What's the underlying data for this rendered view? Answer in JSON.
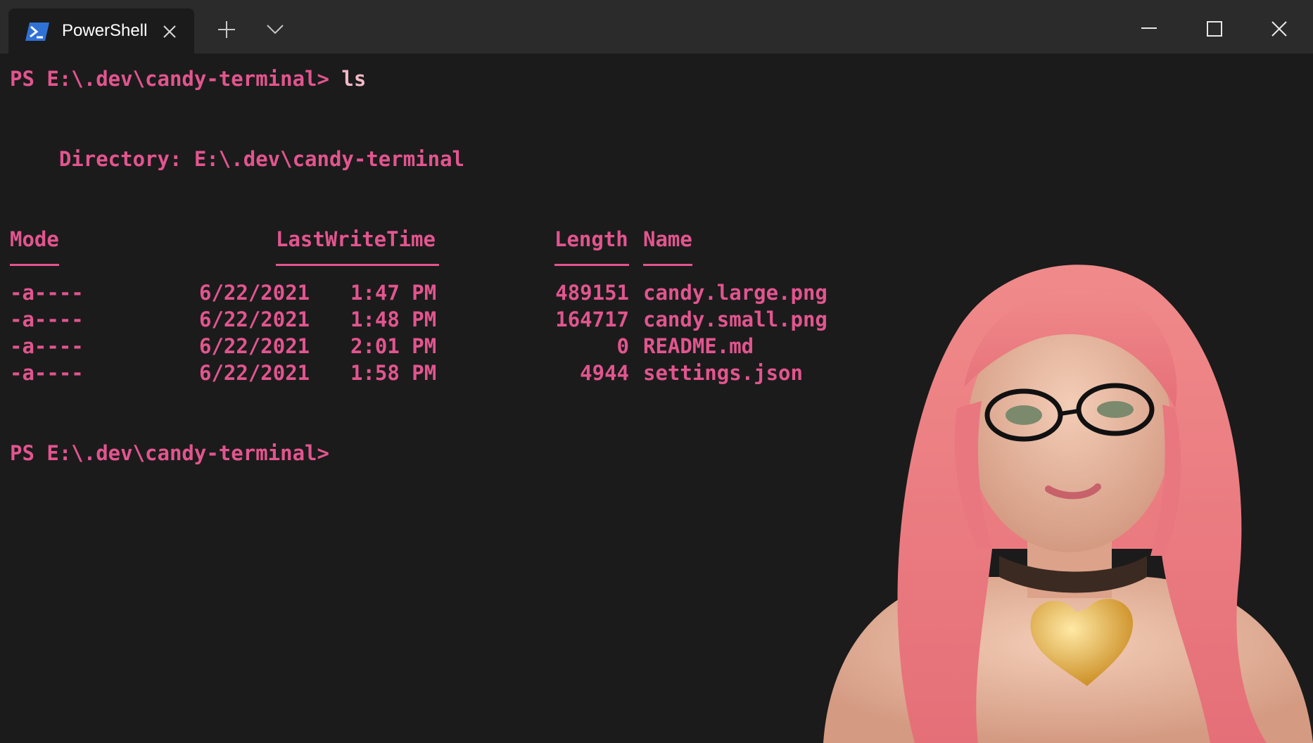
{
  "window": {
    "tab_title": "PowerShell",
    "tab_icon": "powershell-icon",
    "controls": [
      "close-tab-icon",
      "plus-icon",
      "chevron-down-icon",
      "minimize-icon",
      "maximize-icon",
      "close-icon"
    ]
  },
  "terminal": {
    "prompt": "PS E:\\.dev\\candy-terminal>",
    "command": " ls",
    "directory_line": "    Directory: E:\\.dev\\candy-terminal",
    "headers": {
      "mode": "Mode",
      "lastwritetime": "LastWriteTime",
      "length": "Length",
      "name": "Name"
    },
    "rows": [
      {
        "mode": "-a----",
        "date": "6/22/2021",
        "time": "1:47 PM",
        "length": "489151",
        "name": "candy.large.png"
      },
      {
        "mode": "-a----",
        "date": "6/22/2021",
        "time": "1:48 PM",
        "length": "164717",
        "name": "candy.small.png"
      },
      {
        "mode": "-a----",
        "date": "6/22/2021",
        "time": "2:01 PM",
        "length": "0",
        "name": "README.md"
      },
      {
        "mode": "-a----",
        "date": "6/22/2021",
        "time": "1:58 PM",
        "length": "4944",
        "name": "settings.json"
      }
    ],
    "final_prompt": "PS E:\\.dev\\candy-terminal>"
  },
  "colors": {
    "text": "#e2558f",
    "command": "#f2b8c6",
    "background": "#1b1b1b",
    "titlebar": "#2b2b2b"
  }
}
